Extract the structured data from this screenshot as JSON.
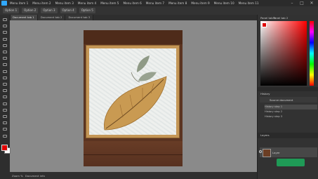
{
  "menubar": {
    "items": [
      "Menu item 1",
      "Menu item 2",
      "Menu item 3",
      "Menu item 4",
      "Menu item 5",
      "Menu item 6",
      "Menu item 7",
      "Menu item 8",
      "Menu item 9",
      "Menu item 10",
      "Menu item 11"
    ]
  },
  "window_controls": {
    "minimize": "–",
    "maximize": "□",
    "close": "✕"
  },
  "options_bar": {
    "items": [
      "Option 1",
      "Option 2",
      "Option 3",
      "Option 4",
      "Option 5"
    ]
  },
  "document_tabs": [
    {
      "label": "Document tab 1",
      "active": true
    },
    {
      "label": "Document tab 2",
      "active": false
    },
    {
      "label": "Document tab 3",
      "active": false
    }
  ],
  "tools": [
    "move-tool",
    "marquee-tool",
    "lasso-tool",
    "crop-tool",
    "eyedropper-tool",
    "healing-tool",
    "brush-tool",
    "stamp-tool",
    "history-brush-tool",
    "eraser-tool",
    "gradient-tool",
    "blur-tool",
    "dodge-tool",
    "pen-tool",
    "type-tool",
    "path-select-tool",
    "rectangle-tool",
    "hand-tool",
    "zoom-tool"
  ],
  "colors": {
    "foreground": "#e00000",
    "background": "#ffffff",
    "accent": "#31a8ff"
  },
  "right_panel": {
    "color_tabs": [
      "Panel tab 1",
      "Panel tab 2"
    ],
    "history_tab": "History",
    "history_source": "Source document",
    "history_items": [
      "History step 1",
      "History step 2",
      "History step 3"
    ],
    "layers_tab": "Layers",
    "layer_name": "Layer"
  },
  "status": {
    "zoom": "Zoom %",
    "info": "Document info"
  }
}
